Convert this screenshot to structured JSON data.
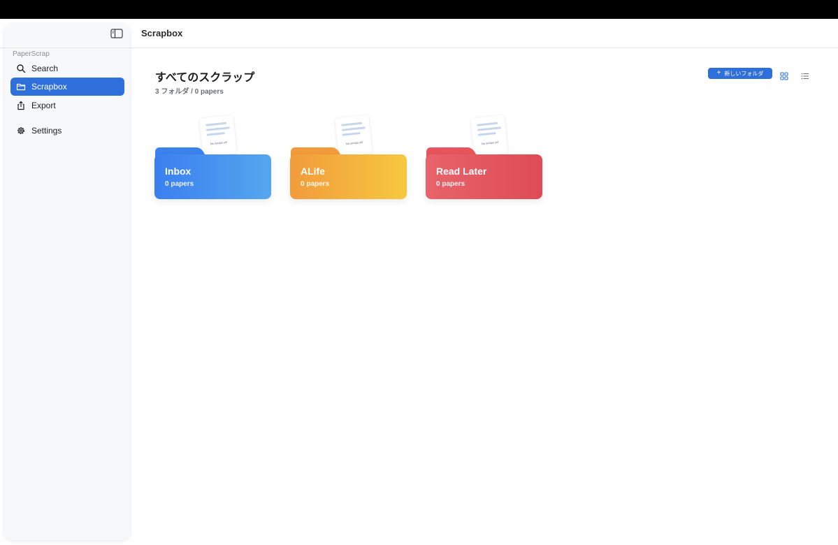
{
  "header": {
    "title": "Scrapbox"
  },
  "sidebar": {
    "section_label": "PaperScrap",
    "items": [
      {
        "label": "Search",
        "icon": "search-icon"
      },
      {
        "label": "Scrapbox",
        "icon": "folder-icon",
        "active": true
      },
      {
        "label": "Export",
        "icon": "share-icon"
      },
      {
        "label": "Settings",
        "icon": "gear-icon"
      }
    ]
  },
  "main": {
    "title": "すべてのスクラップ",
    "subtitle": "3 フォルダ / 0 papers",
    "new_folder_label": "新しいフォルダ",
    "folders": [
      {
        "name": "Inbox",
        "count": "0 papers",
        "paper_text": "No scraps yet",
        "color": "#3a7ff0"
      },
      {
        "name": "ALife",
        "count": "0 papers",
        "paper_text": "No scraps yet",
        "color": "#f29b3b"
      },
      {
        "name": "Read Later",
        "count": "0 papers",
        "paper_text": "No scraps yet",
        "color": "#e5555b"
      }
    ]
  },
  "colors": {
    "accent": "#2f6fdc",
    "sidebar_bg": "#f6f8fa"
  }
}
